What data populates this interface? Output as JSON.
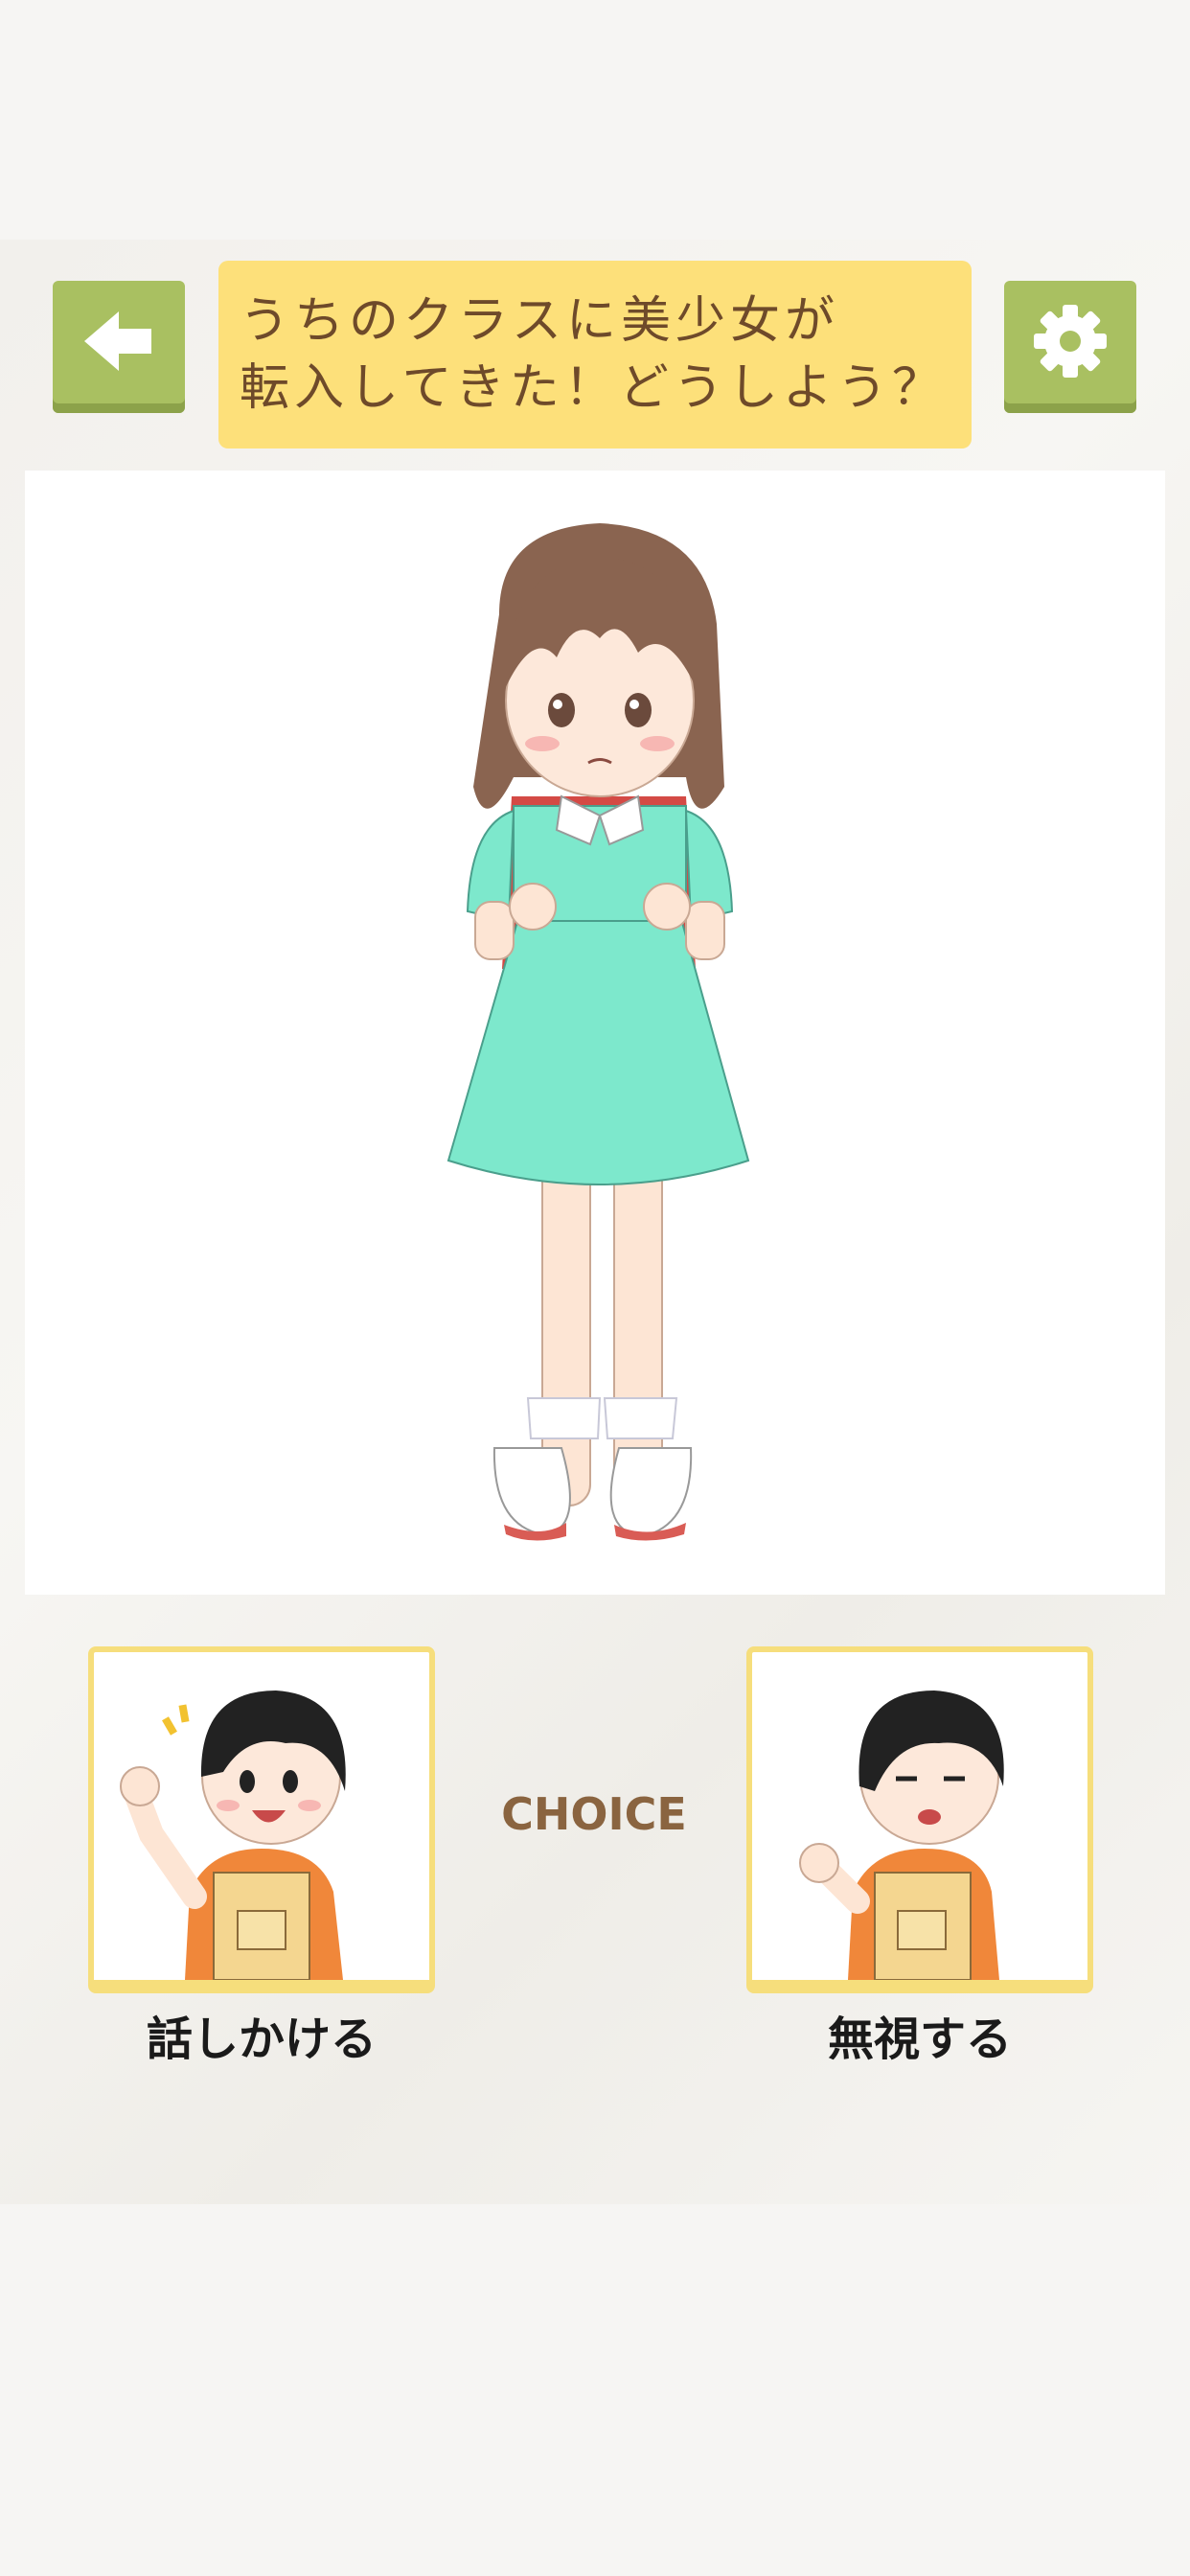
{
  "header": {
    "back_icon": "back-arrow-icon",
    "settings_icon": "gear-icon",
    "question_line1": "うちのクラスに美少女が",
    "question_line2": "転入してきた！どうしよう？"
  },
  "scene": {
    "character": "girl-in-mint-dress-with-red-backpack"
  },
  "choices": {
    "center_label": "CHOICE",
    "left": {
      "label": "話しかける",
      "illustration": "boy-waving-happily"
    },
    "right": {
      "label": "無視する",
      "illustration": "boy-looking-away"
    }
  },
  "colors": {
    "button_green": "#a9c061",
    "title_yellow": "#fde07a",
    "title_text": "#6e4a2a",
    "card_border": "#f6de7c",
    "choice_text": "#8a6440"
  }
}
